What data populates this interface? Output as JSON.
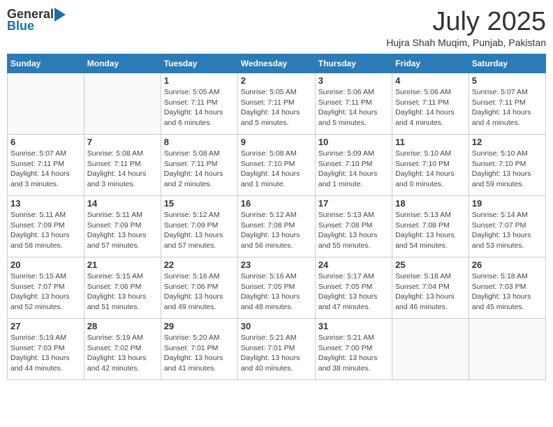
{
  "header": {
    "logo_general": "General",
    "logo_blue": "Blue",
    "title": "July 2025",
    "location": "Hujra Shah Muqim, Punjab, Pakistan"
  },
  "weekdays": [
    "Sunday",
    "Monday",
    "Tuesday",
    "Wednesday",
    "Thursday",
    "Friday",
    "Saturday"
  ],
  "weeks": [
    [
      {
        "day": "",
        "detail": ""
      },
      {
        "day": "",
        "detail": ""
      },
      {
        "day": "1",
        "detail": "Sunrise: 5:05 AM\nSunset: 7:11 PM\nDaylight: 14 hours and 6 minutes."
      },
      {
        "day": "2",
        "detail": "Sunrise: 5:05 AM\nSunset: 7:11 PM\nDaylight: 14 hours and 5 minutes."
      },
      {
        "day": "3",
        "detail": "Sunrise: 5:06 AM\nSunset: 7:11 PM\nDaylight: 14 hours and 5 minutes."
      },
      {
        "day": "4",
        "detail": "Sunrise: 5:06 AM\nSunset: 7:11 PM\nDaylight: 14 hours and 4 minutes."
      },
      {
        "day": "5",
        "detail": "Sunrise: 5:07 AM\nSunset: 7:11 PM\nDaylight: 14 hours and 4 minutes."
      }
    ],
    [
      {
        "day": "6",
        "detail": "Sunrise: 5:07 AM\nSunset: 7:11 PM\nDaylight: 14 hours and 3 minutes."
      },
      {
        "day": "7",
        "detail": "Sunrise: 5:08 AM\nSunset: 7:11 PM\nDaylight: 14 hours and 3 minutes."
      },
      {
        "day": "8",
        "detail": "Sunrise: 5:08 AM\nSunset: 7:11 PM\nDaylight: 14 hours and 2 minutes."
      },
      {
        "day": "9",
        "detail": "Sunrise: 5:08 AM\nSunset: 7:10 PM\nDaylight: 14 hours and 1 minute."
      },
      {
        "day": "10",
        "detail": "Sunrise: 5:09 AM\nSunset: 7:10 PM\nDaylight: 14 hours and 1 minute."
      },
      {
        "day": "11",
        "detail": "Sunrise: 5:10 AM\nSunset: 7:10 PM\nDaylight: 14 hours and 0 minutes."
      },
      {
        "day": "12",
        "detail": "Sunrise: 5:10 AM\nSunset: 7:10 PM\nDaylight: 13 hours and 59 minutes."
      }
    ],
    [
      {
        "day": "13",
        "detail": "Sunrise: 5:11 AM\nSunset: 7:09 PM\nDaylight: 13 hours and 58 minutes."
      },
      {
        "day": "14",
        "detail": "Sunrise: 5:11 AM\nSunset: 7:09 PM\nDaylight: 13 hours and 57 minutes."
      },
      {
        "day": "15",
        "detail": "Sunrise: 5:12 AM\nSunset: 7:09 PM\nDaylight: 13 hours and 57 minutes."
      },
      {
        "day": "16",
        "detail": "Sunrise: 5:12 AM\nSunset: 7:08 PM\nDaylight: 13 hours and 56 minutes."
      },
      {
        "day": "17",
        "detail": "Sunrise: 5:13 AM\nSunset: 7:08 PM\nDaylight: 13 hours and 55 minutes."
      },
      {
        "day": "18",
        "detail": "Sunrise: 5:13 AM\nSunset: 7:08 PM\nDaylight: 13 hours and 54 minutes."
      },
      {
        "day": "19",
        "detail": "Sunrise: 5:14 AM\nSunset: 7:07 PM\nDaylight: 13 hours and 53 minutes."
      }
    ],
    [
      {
        "day": "20",
        "detail": "Sunrise: 5:15 AM\nSunset: 7:07 PM\nDaylight: 13 hours and 52 minutes."
      },
      {
        "day": "21",
        "detail": "Sunrise: 5:15 AM\nSunset: 7:06 PM\nDaylight: 13 hours and 51 minutes."
      },
      {
        "day": "22",
        "detail": "Sunrise: 5:16 AM\nSunset: 7:06 PM\nDaylight: 13 hours and 49 minutes."
      },
      {
        "day": "23",
        "detail": "Sunrise: 5:16 AM\nSunset: 7:05 PM\nDaylight: 13 hours and 48 minutes."
      },
      {
        "day": "24",
        "detail": "Sunrise: 5:17 AM\nSunset: 7:05 PM\nDaylight: 13 hours and 47 minutes."
      },
      {
        "day": "25",
        "detail": "Sunrise: 5:18 AM\nSunset: 7:04 PM\nDaylight: 13 hours and 46 minutes."
      },
      {
        "day": "26",
        "detail": "Sunrise: 5:18 AM\nSunset: 7:03 PM\nDaylight: 13 hours and 45 minutes."
      }
    ],
    [
      {
        "day": "27",
        "detail": "Sunrise: 5:19 AM\nSunset: 7:03 PM\nDaylight: 13 hours and 44 minutes."
      },
      {
        "day": "28",
        "detail": "Sunrise: 5:19 AM\nSunset: 7:02 PM\nDaylight: 13 hours and 42 minutes."
      },
      {
        "day": "29",
        "detail": "Sunrise: 5:20 AM\nSunset: 7:01 PM\nDaylight: 13 hours and 41 minutes."
      },
      {
        "day": "30",
        "detail": "Sunrise: 5:21 AM\nSunset: 7:01 PM\nDaylight: 13 hours and 40 minutes."
      },
      {
        "day": "31",
        "detail": "Sunrise: 5:21 AM\nSunset: 7:00 PM\nDaylight: 13 hours and 38 minutes."
      },
      {
        "day": "",
        "detail": ""
      },
      {
        "day": "",
        "detail": ""
      }
    ]
  ]
}
